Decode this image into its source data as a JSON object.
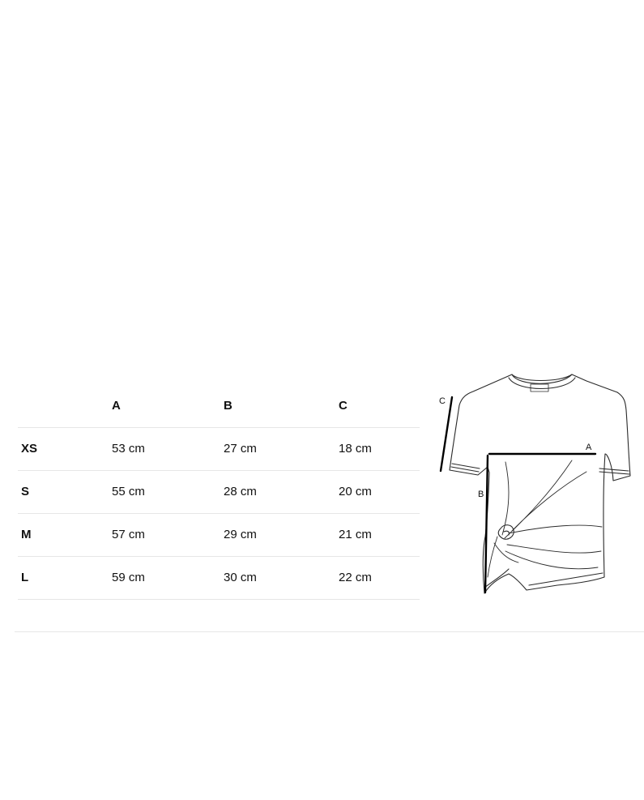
{
  "size_chart": {
    "columns": [
      "",
      "A",
      "B",
      "C"
    ],
    "rows": [
      {
        "size": "XS",
        "a": "53 cm",
        "b": "27 cm",
        "c": "18 cm"
      },
      {
        "size": "S",
        "a": "55 cm",
        "b": "28 cm",
        "c": "20 cm"
      },
      {
        "size": "M",
        "a": "57 cm",
        "b": "29 cm",
        "c": "21 cm"
      },
      {
        "size": "L",
        "a": "59 cm",
        "b": "30 cm",
        "c": "22 cm"
      }
    ]
  },
  "diagram": {
    "icon": "tshirt-measurement-illustration",
    "label_a": "A",
    "label_b": "B",
    "label_c": "C"
  }
}
